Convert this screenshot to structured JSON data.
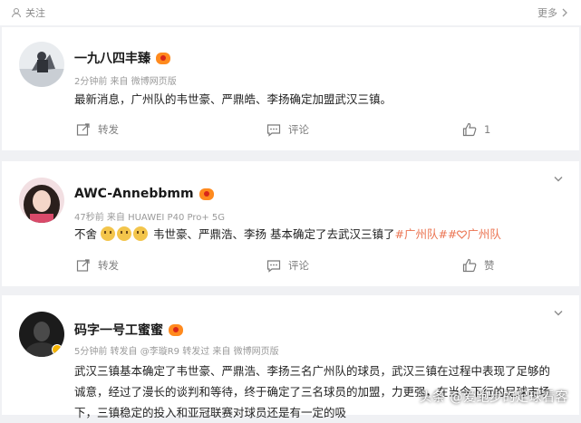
{
  "topbar": {
    "follow_label": "关注",
    "more_label": "更多"
  },
  "posts": [
    {
      "username": "一九八四丰臻",
      "meta": "2分钟前  来自 微博网页版",
      "text": "最新消息，广州队的韦世豪、严鼎皓、李扬确定加盟武汉三镇。",
      "repost_label": "转发",
      "comment_label": "评论",
      "like_count": "1"
    },
    {
      "username": "AWC-Annebbmm",
      "meta": "47秒前  来自 HUAWEI P40 Pro+ 5G",
      "text_prefix": "不舍",
      "text_main": "韦世豪、严鼎浩、李扬 基本确定了去武汉三镇了",
      "hashtag_1": "#广州队#",
      "hashtag_2": "广州队",
      "repost_label": "转发",
      "comment_label": "评论",
      "like_label": "赞"
    },
    {
      "username": "码字一号工蜜蜜",
      "meta": "5分钟前  转发自 @李璇R9 转发过  来自 微博网页版",
      "text": "武汉三镇基本确定了韦世豪、严鼎浩、李扬三名广州队的球员，武汉三镇在过程中表现了足够的诚意，经过了漫长的谈判和等待，终于确定了三名球员的加盟，力更强，在当今下行的足球市场下，三镇稳定的投入和亚冠联赛对球员还是有一定的吸"
    }
  ],
  "watermark": "头条 @爱跑步的足球看客",
  "colors": {
    "accent_hashtag": "#eb7350",
    "vip_badge": "#ff8a1e"
  }
}
